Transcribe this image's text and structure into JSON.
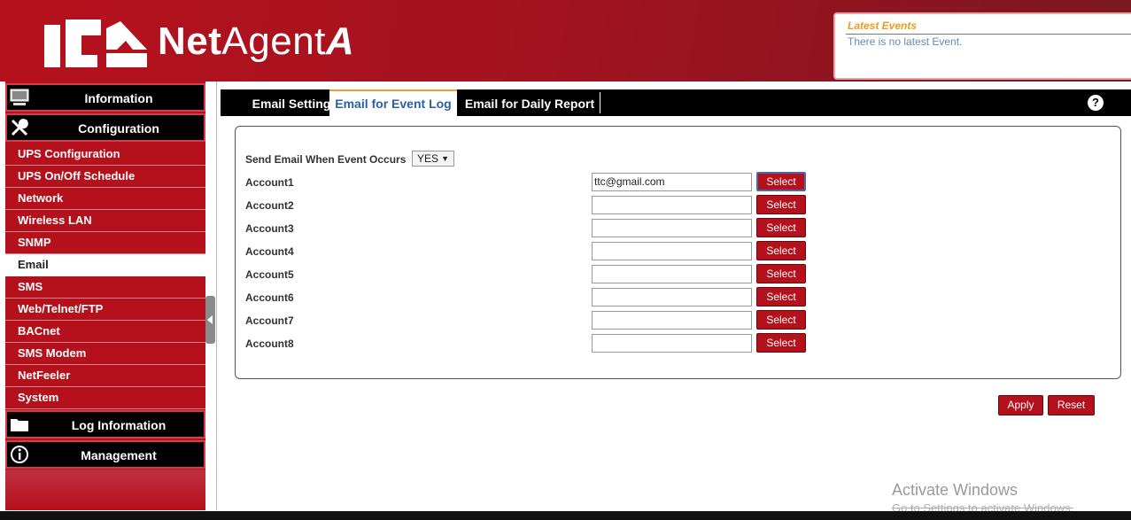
{
  "brand": {
    "name_bold": "Net",
    "name_regular": "Agent",
    "name_italic": "A"
  },
  "latest_events": {
    "title": "Latest Events",
    "text": "There is no latest Event."
  },
  "sidebar": {
    "sections": [
      {
        "label": "Information",
        "icon": "monitor-icon"
      },
      {
        "label": "Configuration",
        "icon": "tools-icon"
      },
      {
        "label": "Log Information",
        "icon": "folder-icon"
      },
      {
        "label": "Management",
        "icon": "info-icon"
      }
    ],
    "items": [
      {
        "label": "UPS Configuration"
      },
      {
        "label": "UPS On/Off Schedule"
      },
      {
        "label": "Network"
      },
      {
        "label": "Wireless LAN"
      },
      {
        "label": "SNMP"
      },
      {
        "label": "Email",
        "active": true
      },
      {
        "label": "SMS"
      },
      {
        "label": "Web/Telnet/FTP"
      },
      {
        "label": "BACnet"
      },
      {
        "label": "SMS Modem"
      },
      {
        "label": "NetFeeler"
      },
      {
        "label": "System"
      }
    ]
  },
  "tabs": [
    {
      "label": "Email Setting"
    },
    {
      "label": "Email for Event Log",
      "selected": true
    },
    {
      "label": "Email for Daily Report"
    }
  ],
  "help_label": "?",
  "form": {
    "send_label": "Send Email When Event Occurs",
    "send_value": "YES",
    "accounts": [
      {
        "label": "Account1",
        "value": "ttc@gmail.com",
        "button": "Select"
      },
      {
        "label": "Account2",
        "value": "",
        "button": "Select"
      },
      {
        "label": "Account3",
        "value": "",
        "button": "Select"
      },
      {
        "label": "Account4",
        "value": "",
        "button": "Select"
      },
      {
        "label": "Account5",
        "value": "",
        "button": "Select"
      },
      {
        "label": "Account6",
        "value": "",
        "button": "Select"
      },
      {
        "label": "Account7",
        "value": "",
        "button": "Select"
      },
      {
        "label": "Account8",
        "value": "",
        "button": "Select"
      }
    ],
    "apply_label": "Apply",
    "reset_label": "Reset"
  },
  "watermark": {
    "line1": "Activate Windows",
    "line2": "Go to Settings to activate Windows."
  },
  "colors": {
    "brand_red": "#b5111c",
    "accent_orange": "#f19a1c",
    "tab_selected_text": "#2a5fa5"
  }
}
